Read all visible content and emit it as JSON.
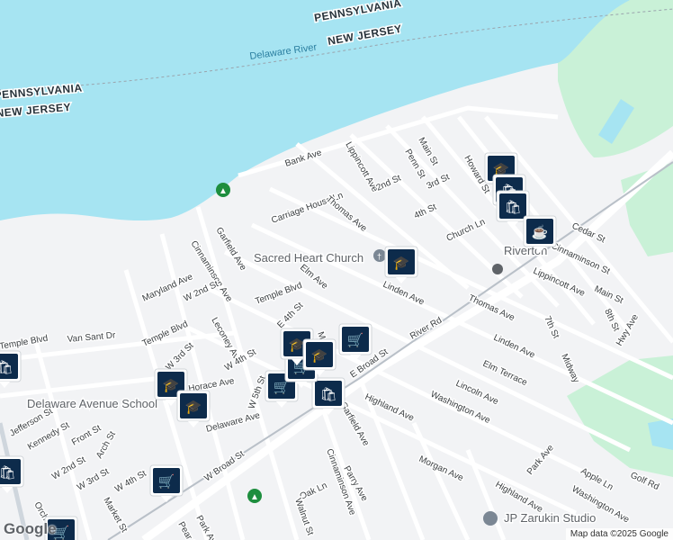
{
  "map": {
    "water_label": "Delaware River",
    "states": [
      {
        "name": "PENNSYLVANIA"
      },
      {
        "name": "NEW JERSEY"
      },
      {
        "name": "PENNSYLVANIA"
      },
      {
        "name": "NEW JERSEY"
      }
    ],
    "streets": [
      "Bank Ave",
      "Lippincott Ave",
      "2nd St",
      "Penn St",
      "3rd St",
      "Main St",
      "Howard St",
      "Carriage House Ln",
      "Thomas Ave",
      "4th St",
      "Church Ln",
      "Cedar St",
      "Cinnaminson St",
      "Garfield Ave",
      "Cinnaminson Ave",
      "Maryland Ave",
      "W 2nd St",
      "Temple Blvd",
      "Elm Ave",
      "Linden Ave",
      "River Rd",
      "Thomas Ave",
      "Lippincott Ave",
      "Main St",
      "Van Sant Dr",
      "Temple Blvd",
      "Leconey Ave",
      "W 4th St",
      "E 4th St",
      "W 3rd St",
      "Linden Ave",
      "7th St",
      "8th St",
      "Midway",
      "Hwy Ave",
      "Elm Terrace",
      "Temple Blvd",
      "Horace Ave",
      "E Broad St",
      "Lincoln Ave",
      "Highland Ave",
      "Washington Ave",
      "Jefferson St",
      "Kennedy St",
      "Front St",
      "Delaware Ave",
      "W 5th St",
      "Garfield Ave",
      "W 2nd St",
      "Arch St",
      "W 3rd St",
      "W 4th St",
      "Parry Ave",
      "Morgan Ave",
      "Park Ave",
      "Highland Ave",
      "Apple Ln",
      "Golf Rd",
      "Washington Ave",
      "W Broad St",
      "Oak Ln",
      "Cinnaminson Ave",
      "Walnut St",
      "Market St",
      "Orchard St",
      "Park Ave",
      "Pear St",
      "Moo"
    ],
    "pois": [
      {
        "name": "Sacred Heart Church"
      },
      {
        "name": "Delaware Avenue School"
      },
      {
        "name": "JP Zarukin Studio"
      },
      {
        "name": "Riverton"
      }
    ],
    "attribution": "Map data ©2025 Google",
    "logo": "Google"
  },
  "colors": {
    "water": "#a6e4f2",
    "park": "#c9f1d7",
    "road": "#ffffff",
    "land": "#f2f3f5",
    "marker": "#0d2b4b"
  }
}
